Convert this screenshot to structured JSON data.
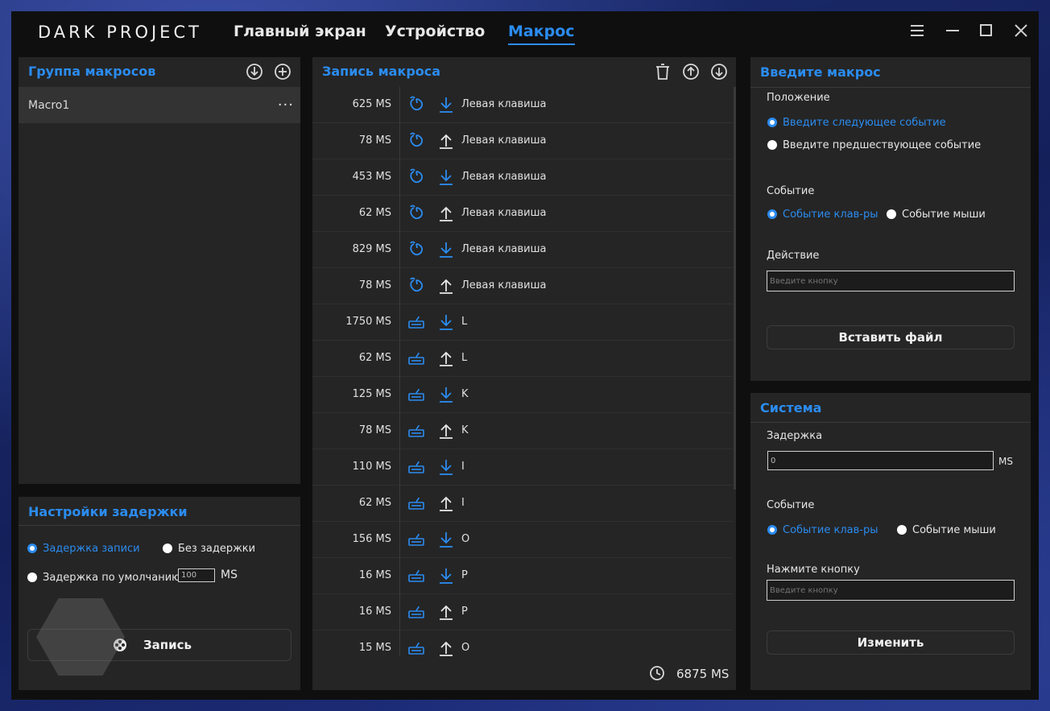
{
  "app": {
    "logo": "DARK PROJECT",
    "tabs": [
      {
        "label": "Главный экран"
      },
      {
        "label": "Устройство"
      },
      {
        "label": "Макрос"
      }
    ],
    "active_tab": "Макрос"
  },
  "colors": {
    "accent": "#2b8cf0",
    "panel": "#252525",
    "window": "#0f0f0f"
  },
  "macro_group": {
    "title": "Группа макросов",
    "items": [
      {
        "name": "Macro1"
      }
    ],
    "menu_glyph": "···"
  },
  "delay_settings": {
    "title": "Настройки задержки",
    "option_record": "Задержка записи",
    "option_none": "Без задержки",
    "option_default": "Задержка по умолчанию",
    "default_value": "100",
    "unit": "MS",
    "record_button": "Запись"
  },
  "record": {
    "title": "Запись макроса",
    "total": "6875 MS",
    "rows": [
      {
        "time": "625 MS",
        "device": "mouse",
        "dir": "down",
        "key": "Левая клавиша"
      },
      {
        "time": "78 MS",
        "device": "mouse",
        "dir": "up",
        "key": "Левая клавиша"
      },
      {
        "time": "453 MS",
        "device": "mouse",
        "dir": "down",
        "key": "Левая клавиша"
      },
      {
        "time": "62 MS",
        "device": "mouse",
        "dir": "up",
        "key": "Левая клавиша"
      },
      {
        "time": "829 MS",
        "device": "mouse",
        "dir": "down",
        "key": "Левая клавиша"
      },
      {
        "time": "78 MS",
        "device": "mouse",
        "dir": "up",
        "key": "Левая клавиша"
      },
      {
        "time": "1750 MS",
        "device": "keyboard",
        "dir": "down",
        "key": "L"
      },
      {
        "time": "62 MS",
        "device": "keyboard",
        "dir": "up",
        "key": "L"
      },
      {
        "time": "125 MS",
        "device": "keyboard",
        "dir": "down",
        "key": "K"
      },
      {
        "time": "78 MS",
        "device": "keyboard",
        "dir": "up",
        "key": "K"
      },
      {
        "time": "110 MS",
        "device": "keyboard",
        "dir": "down",
        "key": "I"
      },
      {
        "time": "62 MS",
        "device": "keyboard",
        "dir": "up",
        "key": "I"
      },
      {
        "time": "156 MS",
        "device": "keyboard",
        "dir": "down",
        "key": "O"
      },
      {
        "time": "16 MS",
        "device": "keyboard",
        "dir": "down",
        "key": "P"
      },
      {
        "time": "16 MS",
        "device": "keyboard",
        "dir": "up",
        "key": "P"
      },
      {
        "time": "15 MS",
        "device": "keyboard",
        "dir": "up",
        "key": "O"
      }
    ]
  },
  "enter_macro": {
    "title": "Введите макрос",
    "position_label": "Положение",
    "position_next": "Введите следующее событие",
    "position_prev": "Введите предшествующее событие",
    "event_label": "Событие",
    "event_keyboard": "Событие клав-ры",
    "event_mouse": "Событие мыши",
    "action_label": "Действие",
    "action_placeholder": "Введите кнопку",
    "insert_file_button": "Вставить файл"
  },
  "system": {
    "title": "Система",
    "delay_label": "Задержка",
    "delay_value": "0",
    "delay_unit": "MS",
    "event_label": "Событие",
    "event_keyboard": "Событие клав-ры",
    "event_mouse": "Событие мыши",
    "press_label": "Нажмите кнопку",
    "press_placeholder": "Введите кнопку",
    "change_button": "Изменить"
  }
}
